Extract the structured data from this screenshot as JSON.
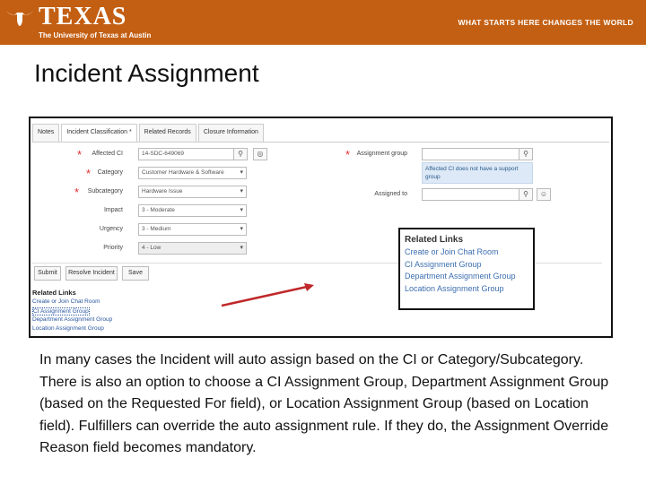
{
  "header": {
    "logo_word": "TEXAS",
    "logo_sub": "The University of Texas at Austin",
    "tagline": "WHAT STARTS HERE CHANGES THE WORLD"
  },
  "slide_title": "Incident Assignment",
  "form": {
    "tabs": [
      "Notes",
      "Incident Classification *",
      "Related Records",
      "Closure Information"
    ],
    "fields": {
      "affected_ci": {
        "label": "Affected CI",
        "value": "14-SDC-649069"
      },
      "category": {
        "label": "Category",
        "value": "Customer Hardware & Software"
      },
      "subcategory": {
        "label": "Subcategory",
        "value": "Hardware Issue"
      },
      "impact": {
        "label": "Impact",
        "value": "3 - Moderate"
      },
      "urgency": {
        "label": "Urgency",
        "value": "3 - Medium"
      },
      "priority": {
        "label": "Priority",
        "value": "4 - Low"
      },
      "assignment_group": {
        "label": "Assignment group",
        "value": ""
      },
      "assigned_to": {
        "label": "Assigned to",
        "value": ""
      }
    },
    "hint": "Affected CI does not have a support group",
    "buttons": {
      "submit": "Submit",
      "resolve": "Resolve Incident",
      "save": "Save"
    },
    "related_links": {
      "heading": "Related Links",
      "items": [
        "Create or Join Chat Room",
        "CI Assignment Group",
        "Department Assignment Group",
        "Location Assignment Group"
      ]
    }
  },
  "callout": {
    "heading": "Related Links",
    "items": [
      "Create or Join Chat Room",
      "CI Assignment Group",
      "Department Assignment Group",
      "Location Assignment Group"
    ]
  },
  "body_text": "In many cases the Incident will auto assign based on the CI or Category/Subcategory. There is also an option to choose a CI Assignment Group, Department Assignment Group (based on the Requested For field), or Location Assignment Group (based on Location field). Fulfillers can override the auto assignment rule. If they do, the Assignment Override Reason field becomes mandatory.",
  "colors": {
    "brand": "#c35f13",
    "required": "#e03030",
    "link": "#3d6fb0",
    "arrow": "#c0282b"
  }
}
